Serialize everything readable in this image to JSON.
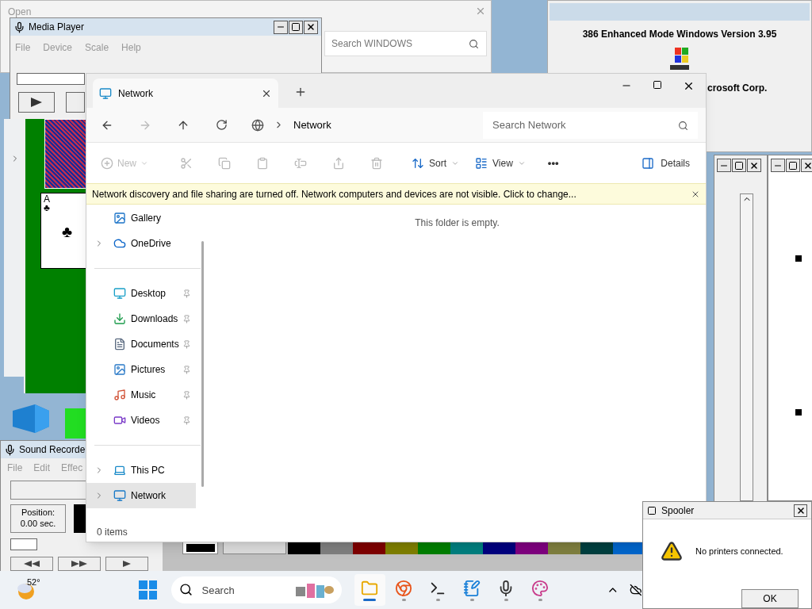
{
  "open_window": {
    "title": "Open",
    "search": {
      "placeholder": "Search WINDOWS"
    }
  },
  "media_player": {
    "title": "Media Player",
    "menu": [
      "File",
      "Device",
      "Scale",
      "Help"
    ]
  },
  "about_window": {
    "version": "386 Enhanced Mode Windows Version 3.95",
    "copyright": "crosoft Corp."
  },
  "solitaire": {
    "card_rank": "A",
    "card_suit": "♣",
    "card_suit_large": "♣"
  },
  "explorer": {
    "tab": {
      "label": "Network",
      "selected": true
    },
    "address": "Network",
    "search": {
      "placeholder": "Search Network"
    },
    "toolbar": [
      {
        "kind": "new",
        "label": "New",
        "disabled": true
      },
      {
        "kind": "icon",
        "disabled": true
      },
      {
        "kind": "icon",
        "disabled": true
      },
      {
        "kind": "icon",
        "disabled": true
      },
      {
        "kind": "icon",
        "disabled": true
      },
      {
        "kind": "icon",
        "disabled": true
      },
      {
        "kind": "icon",
        "disabled": true
      },
      {
        "kind": "dropdown",
        "label": "Sort",
        "disabled": false
      },
      {
        "kind": "dropdown",
        "label": "View",
        "disabled": false
      },
      {
        "kind": "more",
        "label": "•••",
        "disabled": false
      }
    ],
    "details": "Details",
    "banner": "Network discovery and file sharing are turned off. Network computers and devices are not visible. Click to change...",
    "nav_groups": [
      [
        {
          "label": "Gallery",
          "kind": "plain",
          "selected": false
        },
        {
          "label": "OneDrive",
          "kind": "expander",
          "selected": false
        }
      ],
      [
        {
          "label": "Desktop",
          "kind": "pinned",
          "selected": false
        },
        {
          "label": "Downloads",
          "kind": "pinned",
          "selected": false
        },
        {
          "label": "Documents",
          "kind": "pinned",
          "selected": false
        },
        {
          "label": "Pictures",
          "kind": "pinned",
          "selected": false
        },
        {
          "label": "Music",
          "kind": "pinned",
          "selected": false
        },
        {
          "label": "Videos",
          "kind": "pinned",
          "selected": false
        }
      ],
      [
        {
          "label": "This PC",
          "kind": "expander",
          "selected": false
        },
        {
          "label": "Network",
          "kind": "expander",
          "selected": true
        }
      ]
    ],
    "empty_message": "This folder is empty.",
    "status": "0 items"
  },
  "sound_recorder": {
    "title": "Sound Recorde",
    "menu": [
      "File",
      "Edit",
      "Effec"
    ],
    "position_label": "Position:",
    "position_value": "0.00 sec."
  },
  "palette": [
    {
      "color": "#000000"
    },
    {
      "color": "#808080"
    },
    {
      "color": "#800000"
    },
    {
      "color": "#808000"
    },
    {
      "color": "#008000"
    },
    {
      "color": "#008080"
    },
    {
      "color": "#000080"
    },
    {
      "color": "#800080"
    },
    {
      "color": "#808040"
    },
    {
      "color": "#004040"
    },
    {
      "color": "#0066cc"
    }
  ],
  "spooler": {
    "title": "Spooler",
    "message": "No printers connected.",
    "button": "OK"
  },
  "taskbar": {
    "weather": "52°",
    "search_placeholder": "Search",
    "apps": [
      {
        "selected": true
      },
      {
        "selected": false
      },
      {
        "selected": false
      },
      {
        "selected": false
      },
      {
        "selected": false
      },
      {
        "selected": false
      }
    ]
  }
}
